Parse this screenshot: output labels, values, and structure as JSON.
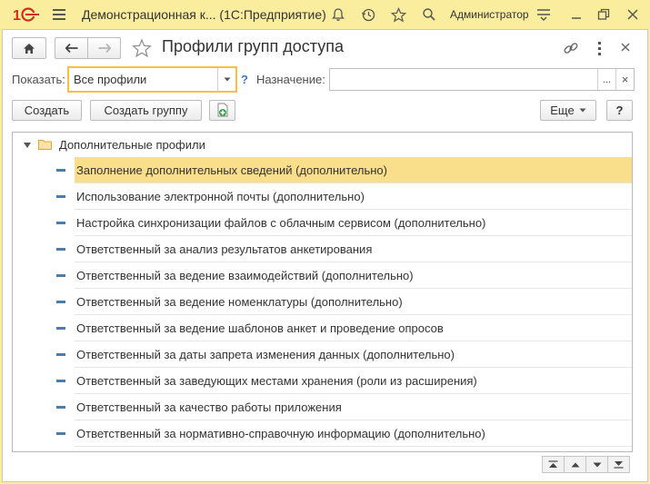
{
  "app": {
    "title": "Демонстрационная к...  (1С:Предприятие)",
    "user": "Администратор"
  },
  "form": {
    "title": "Профили групп доступа",
    "show_label": "Показать:",
    "show_value": "Все профили",
    "purpose_label": "Назначение:",
    "purpose_value": "",
    "help_mark": "?",
    "ellipsis": "...",
    "clear": "×"
  },
  "toolbar": {
    "create": "Создать",
    "create_group": "Создать группу",
    "more": "Еще",
    "help": "?"
  },
  "list": {
    "group": "Дополнительные профили",
    "items": [
      "Заполнение дополнительных сведений (дополнительно)",
      "Использование электронной почты (дополнительно)",
      "Настройка синхронизации файлов с облачным сервисом (дополнительно)",
      "Ответственный за анализ результатов анкетирования",
      "Ответственный за ведение взаимодействий (дополнительно)",
      "Ответственный за ведение номенклатуры (дополнительно)",
      "Ответственный за ведение шаблонов анкет и проведение опросов",
      "Ответственный за даты запрета изменения данных (дополнительно)",
      "Ответственный за заведующих местами хранения (роли из расширения)",
      "Ответственный за качество работы приложения",
      "Ответственный за нормативно-справочную информацию (дополнительно)"
    ],
    "selected_index": 0
  },
  "colors": {
    "titlebar": "#fbed9e",
    "selection": "#f9de8c",
    "active_field_border": "#f5c142",
    "accent_red": "#d52b1e"
  }
}
